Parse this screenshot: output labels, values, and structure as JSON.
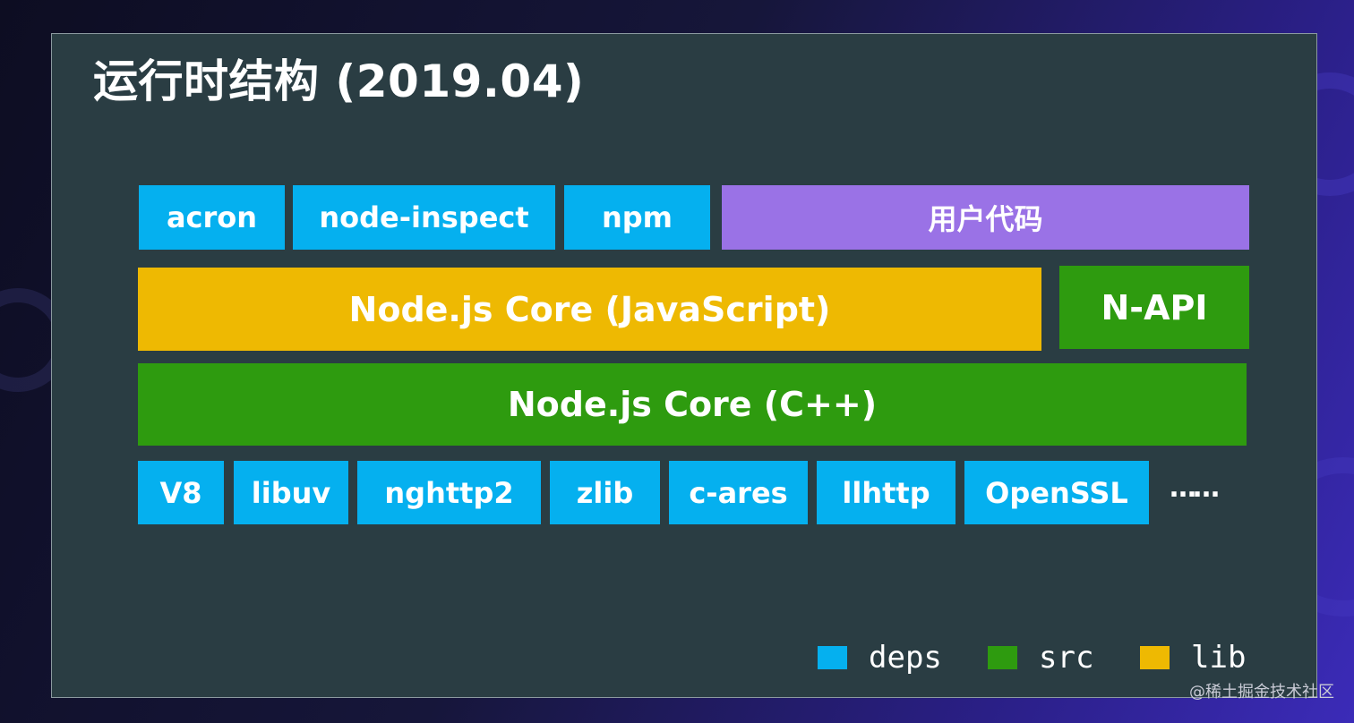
{
  "title": "运行时结构 (2019.04)",
  "rows": {
    "top": [
      {
        "label": "acron",
        "category": "deps"
      },
      {
        "label": "node-inspect",
        "category": "deps"
      },
      {
        "label": "npm",
        "category": "deps"
      },
      {
        "label": "用户代码",
        "category": "user"
      }
    ],
    "middle": [
      {
        "label": "Node.js Core (JavaScript)",
        "category": "lib"
      },
      {
        "label": "N-API",
        "category": "src"
      }
    ],
    "core": {
      "label": "Node.js Core (C++)",
      "category": "src"
    },
    "bottom": [
      {
        "label": "V8",
        "category": "deps"
      },
      {
        "label": "libuv",
        "category": "deps"
      },
      {
        "label": "nghttp2",
        "category": "deps"
      },
      {
        "label": "zlib",
        "category": "deps"
      },
      {
        "label": "c-ares",
        "category": "deps"
      },
      {
        "label": "llhttp",
        "category": "deps"
      },
      {
        "label": "OpenSSL",
        "category": "deps"
      }
    ],
    "more": "……"
  },
  "legend": [
    {
      "label": "deps",
      "color": "#05b0ef"
    },
    {
      "label": "src",
      "color": "#2e9b0f"
    },
    {
      "label": "lib",
      "color": "#eeb902"
    }
  ],
  "colors": {
    "deps": "#05b0ef",
    "src": "#2e9b0f",
    "lib": "#eeb902",
    "user": "#9a72e6",
    "panel": "#2a3d43"
  },
  "watermark": "@稀土掘金技术社区"
}
